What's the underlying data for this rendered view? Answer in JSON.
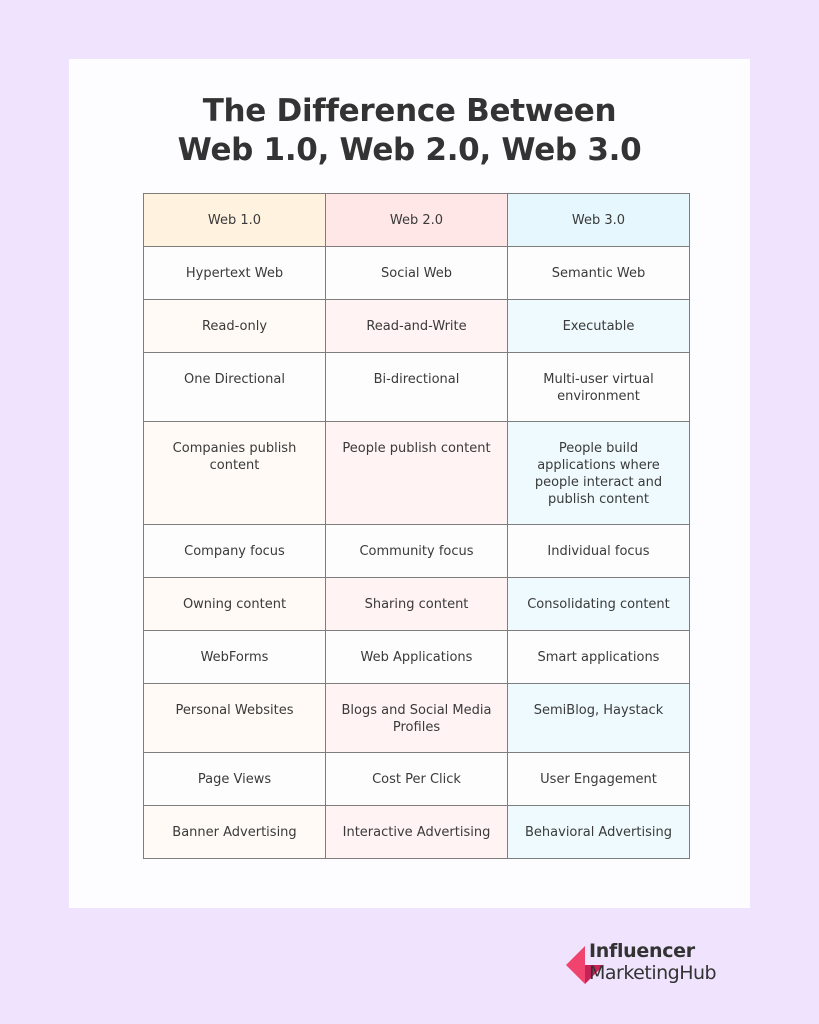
{
  "title": {
    "line1": "The Difference Between",
    "line2": "Web 1.0,  Web 2.0, Web 3.0"
  },
  "table": {
    "headers": [
      "Web 1.0",
      "Web 2.0",
      "Web 3.0"
    ],
    "rows": [
      [
        "Hypertext Web",
        "Social Web",
        "Semantic Web"
      ],
      [
        "Read-only",
        "Read-and-Write",
        "Executable"
      ],
      [
        "One Directional",
        "Bi-directional",
        "Multi-user virtual environment"
      ],
      [
        "Companies publish content",
        "People publish content",
        "People build applications where people interact and publish content"
      ],
      [
        "Company focus",
        "Community focus",
        "Individual focus"
      ],
      [
        "Owning content",
        "Sharing content",
        "Consolidating content"
      ],
      [
        "WebForms",
        "Web Applications",
        "Smart applications"
      ],
      [
        "Personal Websites",
        "Blogs and Social Media Profiles",
        "SemiBlog, Haystack"
      ],
      [
        "Page Views",
        "Cost Per Click",
        "User Engagement"
      ],
      [
        "Banner Advertising",
        "Interactive Advertising",
        "Behavioral Advertising"
      ]
    ]
  },
  "logo": {
    "line1": "Influencer",
    "line2": "MarketingHub",
    "icon": "diamond-logo-icon",
    "colors": {
      "light": "#f0446f",
      "dark": "#c82157"
    }
  },
  "colors": {
    "background": "#efe3fd",
    "card": "#fdfcff",
    "web1_header": "#fff3e0",
    "web2_header": "#ffe6e7",
    "web3_header": "#e6f7fd"
  }
}
